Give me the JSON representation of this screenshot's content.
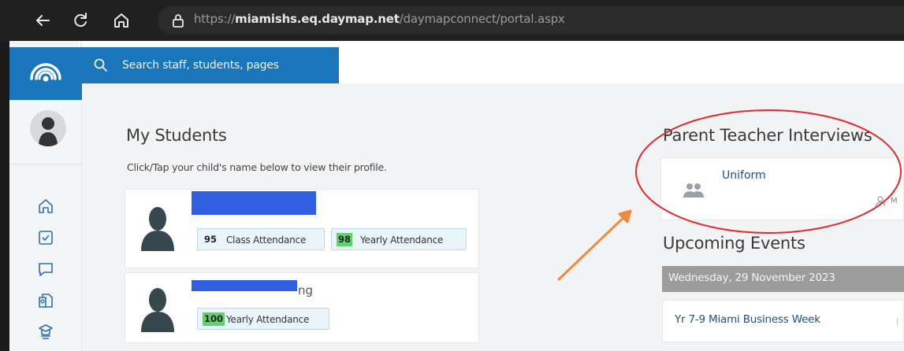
{
  "browser": {
    "url_prefix": "https://",
    "url_domain": "miamishs.eq.daymap.net",
    "url_path": "/daymapconnect/portal.aspx",
    "icons": [
      "back-icon",
      "reload-icon",
      "home-icon",
      "lock-icon"
    ]
  },
  "search": {
    "placeholder": "Search staff, students, pages"
  },
  "sidebar": {
    "icons": [
      "home-icon",
      "checkbox-icon",
      "chat-icon",
      "document-icon",
      "school-icon"
    ]
  },
  "students": {
    "title": "My Students",
    "subtitle": "Click/Tap your child's name below to view their profile.",
    "cards": [
      {
        "name_visible_fragment": "",
        "attendance": [
          {
            "value": "95",
            "label": "Class Attendance",
            "highlight": false
          },
          {
            "value": "98",
            "label": "Yearly Attendance",
            "highlight": true
          }
        ]
      },
      {
        "name_visible_fragment": "ng",
        "attendance": [
          {
            "value": "100",
            "label": "Yearly Attendance",
            "highlight": true
          }
        ]
      }
    ]
  },
  "pti": {
    "title": "Parent Teacher Interviews",
    "item_title": "Uniform",
    "item_meta_fragment": "M"
  },
  "events": {
    "title": "Upcoming Events",
    "date_header": "Wednesday, 29 November 2023",
    "items": [
      {
        "title": "Yr 7-9 Miami Business Week"
      }
    ]
  },
  "colors": {
    "brand_blue": "#1b75bb",
    "attendance_green": "#5fd26b",
    "annotation_red": "#e0282e",
    "annotation_orange": "#f08a3c",
    "redaction_blue": "#2f5fe0"
  }
}
